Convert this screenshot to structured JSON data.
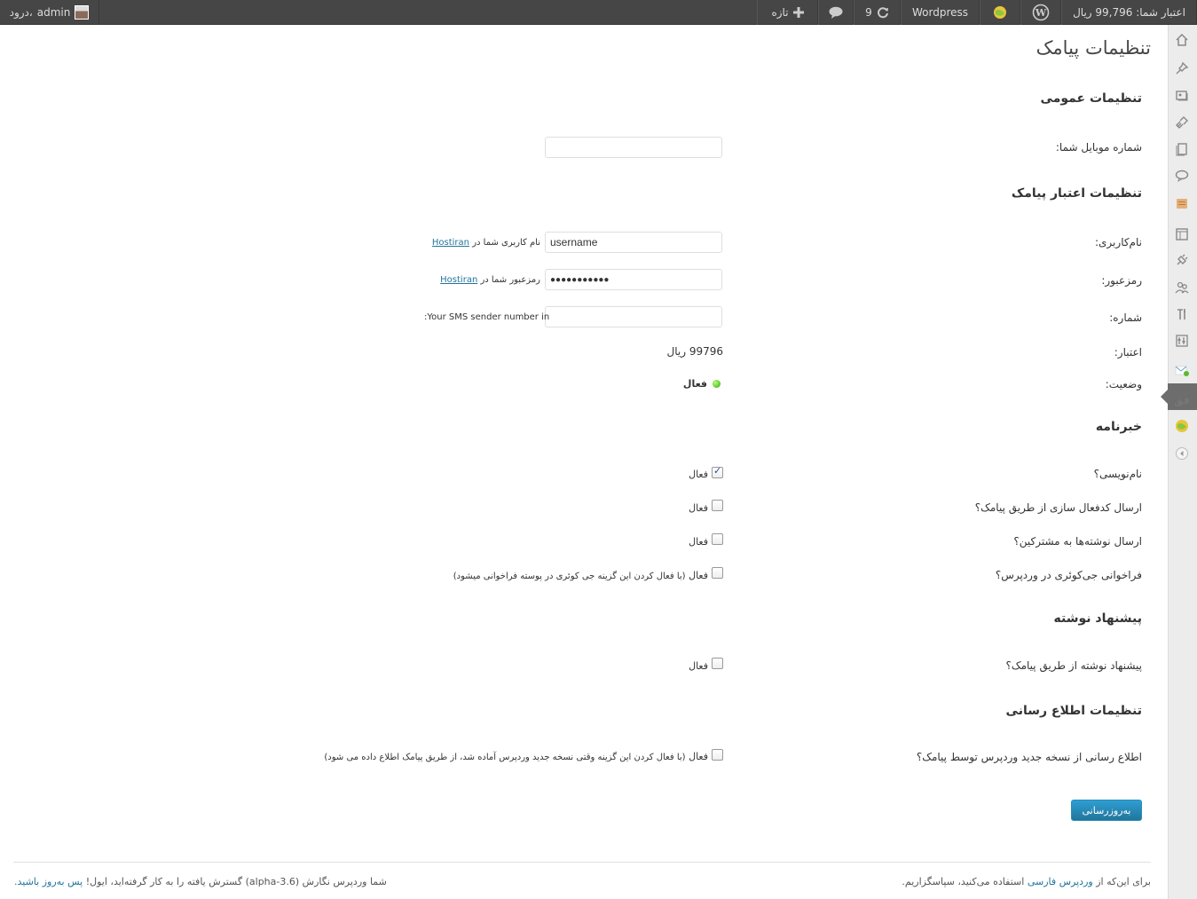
{
  "adminbar": {
    "credit": "اعتبار شما: 99,796 ریال",
    "site_name": "Wordpress",
    "updates_count": "9",
    "new_label": "تازه",
    "greeting": "درود،",
    "user": "admin"
  },
  "page": {
    "title": "تنظیمات پیامک"
  },
  "general": {
    "heading": "تنظیمات عمومی",
    "mobile_label": "شماره موبایل شما:",
    "mobile_value": ""
  },
  "credit_settings": {
    "heading": "تنظیمات اعتبار پیامک",
    "username_label": "نام‌کاربری:",
    "username_value": "username",
    "username_desc": "نام کاربری شما در",
    "password_label": "رمزعبور:",
    "password_value": "●●●●●●●●●●●",
    "password_desc": "رمزعبور شما در",
    "provider_link": "Hostiran",
    "number_label": "شماره:",
    "number_value": "",
    "number_desc": ":Your SMS sender number in",
    "credit_label": "اعتبار:",
    "credit_value": "99796 ریال",
    "status_label": "وضعیت:",
    "status_value": "فعال"
  },
  "newsletter": {
    "heading": "خبرنامه",
    "subscribe_label": "نام‌نویسی؟",
    "activation_label": "ارسال کدفعال سازی از طریق پیامک؟",
    "posts_label": "ارسال نوشته‌ها به مشترکین؟",
    "gcourier_label": "فراخوانی جی‌کوئری در وردپرس؟",
    "active_label": "فعال",
    "gcourier_desc": "(با فعال کردن این گزینه جی کوئری در پوسته فراخوانی میشود)",
    "subscribe_checked": true,
    "activation_checked": false,
    "posts_checked": false,
    "gcourier_checked": false
  },
  "suggest": {
    "heading": "پیشنهاد نوشته",
    "label": "پیشنهاد نوشته از طریق پیامک؟",
    "active_label": "فعال",
    "checked": false
  },
  "notify": {
    "heading": "تنظیمات اطلاع رسانی",
    "label": "اطلاع رسانی از نسخه جدید وردپرس توسط پیامک؟",
    "active_label": "فعال",
    "desc": "(با فعال کردن این گزینه وقتی نسخه جدید وردپرس آماده شد، از طریق پیامک اطلاع داده می شود)",
    "checked": false
  },
  "submit_label": "به‌روزرسانی",
  "footer": {
    "right_prefix": "برای این‌که از",
    "right_link": "وردپرس فارسی",
    "right_suffix": "استفاده می‌کنید، سپاسگزاریم.",
    "left_text": "شما وردپرس نگارش (alpha-3.6) گسترش یافته را به کار گرفته‌اید، ایول!",
    "left_link": "پس به‌روز باشید."
  },
  "icons": [
    "home-icon",
    "pin-icon",
    "media-icon",
    "links-icon",
    "pages-icon",
    "comments-icon",
    "sms-icon",
    "appearance-icon",
    "plugins-icon",
    "users-icon",
    "tools-icon",
    "settings-icon",
    "mail-icon",
    "fa-icon",
    "ball-icon",
    "collapse-icon"
  ]
}
